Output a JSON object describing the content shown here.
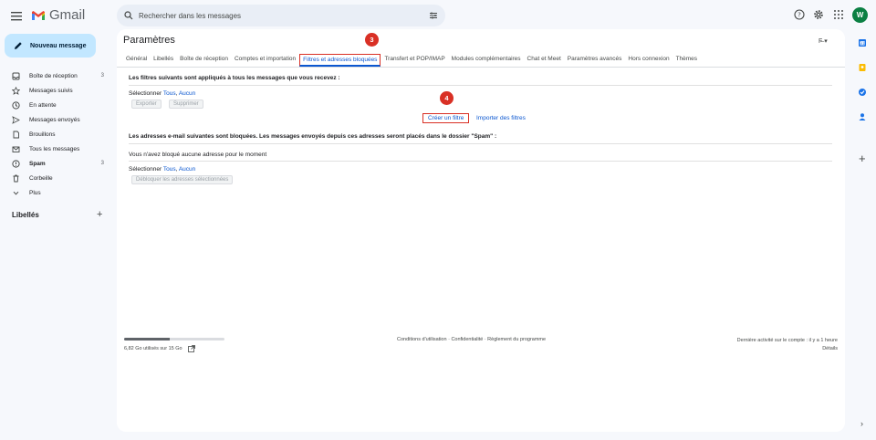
{
  "header": {
    "logo_text": "Gmail",
    "search_placeholder": "Rechercher dans les messages",
    "avatar_letter": "W"
  },
  "compose": {
    "label": "Nouveau message"
  },
  "nav": [
    {
      "label": "Boîte de réception",
      "count": "3",
      "bold": true,
      "icon": "inbox-icon"
    },
    {
      "label": "Messages suivis",
      "count": "",
      "bold": false,
      "icon": "star-icon"
    },
    {
      "label": "En attente",
      "count": "",
      "bold": false,
      "icon": "clock-icon"
    },
    {
      "label": "Messages envoyés",
      "count": "",
      "bold": false,
      "icon": "send-icon"
    },
    {
      "label": "Brouillons",
      "count": "",
      "bold": false,
      "icon": "draft-icon"
    },
    {
      "label": "Tous les messages",
      "count": "",
      "bold": false,
      "icon": "all-mail-icon"
    },
    {
      "label": "Spam",
      "count": "3",
      "bold": true,
      "icon": "spam-icon"
    },
    {
      "label": "Corbeille",
      "count": "",
      "bold": false,
      "icon": "trash-icon"
    },
    {
      "label": "Plus",
      "count": "",
      "bold": false,
      "icon": "chevron-down-icon"
    }
  ],
  "labels": {
    "title": "Libellés",
    "add": "+"
  },
  "settings": {
    "title": "Paramètres",
    "lang": "F̶ ▾",
    "tabs": [
      {
        "label": "Général",
        "active": false
      },
      {
        "label": "Libellés",
        "active": false
      },
      {
        "label": "Boîte de réception",
        "active": false
      },
      {
        "label": "Comptes et importation",
        "active": false
      },
      {
        "label": "Filtres et adresses bloquées",
        "active": true
      },
      {
        "label": "Transfert et POP/IMAP",
        "active": false
      },
      {
        "label": "Modules complémentaires",
        "active": false
      },
      {
        "label": "Chat et Meet",
        "active": false
      },
      {
        "label": "Paramètres avancés",
        "active": false
      },
      {
        "label": "Hors connexion",
        "active": false
      },
      {
        "label": "Thèmes",
        "active": false
      }
    ]
  },
  "markers": {
    "tab": "3",
    "create": "4"
  },
  "filters": {
    "title": "Les filtres suivants sont appliqués à tous les messages que vous recevez :",
    "select_label": "Sélectionner",
    "select_all": "Tous",
    "select_none": "Aucun",
    "export": "Exporter",
    "delete": "Supprimer",
    "create": "Créer un filtre",
    "import": "Importer des filtres"
  },
  "blocked": {
    "title": "Les adresses e-mail suivantes sont bloquées. Les messages envoyés depuis ces adresses seront placés dans le dossier \"Spam\" :",
    "empty": "Vous n'avez bloqué aucune adresse pour le moment",
    "select_label": "Sélectionner",
    "select_all": "Tous",
    "select_none": "Aucun",
    "unblock": "Débloquer les adresses sélectionnées"
  },
  "footer": {
    "storage": "6,82 Go utilisés sur 15 Go",
    "storage_fraction": 0.45,
    "links": "Conditions d'utilisation · Confidentialité · Règlement du programme",
    "activity": "Dernière activité sur le compte : il y a 1 heure",
    "details": "Détails"
  },
  "colors": {
    "accent": "#0b57d0",
    "marker": "#d93025",
    "compose": "#c2e7ff"
  }
}
